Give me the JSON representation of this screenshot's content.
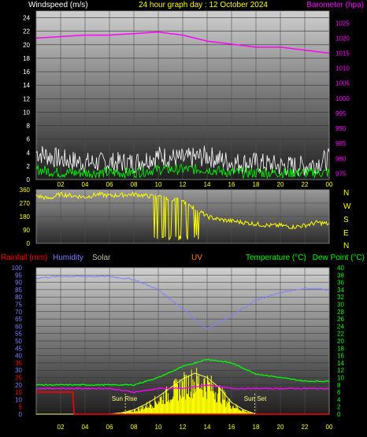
{
  "header": {
    "windspeed_label": "Windspeed (m/s)",
    "title": "24 hour graph day : 12 October 2024",
    "barometer_label": "Barometer (hpa)"
  },
  "compass": [
    "N",
    "W",
    "S",
    "E",
    "N"
  ],
  "legend": {
    "rainfall": "Rainfall (mm)",
    "humidity": "Humidity",
    "solar": "Solar",
    "uv": "UV",
    "temperature": "Temperature (°C)",
    "dewpoint": "Dew Point (°C)"
  },
  "annotations": {
    "sunrise": "Sun Rise",
    "sunset": "Sun Set"
  },
  "colors": {
    "wind_label": "#ffffff",
    "title": "#ffff00",
    "barometer": "#ff00ff",
    "rain": "#ff0000",
    "humidity": "#8080ff",
    "solar": "#c0c0a0",
    "uv": "#ff8000",
    "temperature": "#00ff00",
    "dewpoint": "#00ff00",
    "direction": "#ffff00"
  },
  "chart_data": [
    {
      "type": "line",
      "title": "24 hour graph day : 12 October 2024",
      "x_ticks": [
        "02",
        "04",
        "06",
        "08",
        "10",
        "12",
        "14",
        "16",
        "18",
        "20",
        "22",
        "00"
      ],
      "left_axis": {
        "label": "Windspeed (m/s)",
        "ylim": [
          0,
          25
        ],
        "ticks": [
          0,
          2,
          4,
          6,
          8,
          10,
          12,
          14,
          16,
          18,
          20,
          22,
          24
        ]
      },
      "right_axis": {
        "label": "Barometer (hpa)",
        "ylim": [
          973,
          1029
        ],
        "ticks": [
          975,
          980,
          985,
          990,
          995,
          1000,
          1005,
          1010,
          1015,
          1020,
          1025
        ]
      },
      "series": [
        {
          "name": "Barometer (hpa)",
          "axis": "right",
          "x": [
            0,
            2,
            4,
            6,
            8,
            10,
            12,
            14,
            16,
            18,
            20,
            22,
            24
          ],
          "values": [
            1020,
            1020.5,
            1021,
            1021,
            1021.5,
            1022,
            1021,
            1019,
            1018,
            1017,
            1017,
            1016,
            1015
          ]
        },
        {
          "name": "gust",
          "axis": "left",
          "x": [
            0,
            2,
            4,
            6,
            8,
            10,
            12,
            14,
            16,
            18,
            20,
            22,
            24
          ],
          "values": [
            4,
            3,
            2.5,
            2.5,
            2.5,
            3.5,
            3,
            3.5,
            2.5,
            2.5,
            2,
            2,
            3
          ]
        },
        {
          "name": "average",
          "axis": "left",
          "x": [
            0,
            2,
            4,
            6,
            8,
            10,
            12,
            14,
            16,
            18,
            20,
            22,
            24
          ],
          "values": [
            1.5,
            1,
            1,
            1,
            1,
            1.5,
            1.5,
            1.5,
            1,
            1,
            1,
            1,
            1
          ]
        }
      ]
    },
    {
      "type": "scatter",
      "x_ticks": [
        "02",
        "04",
        "06",
        "08",
        "10",
        "12",
        "14",
        "16",
        "18",
        "20",
        "22",
        "00"
      ],
      "ylim": [
        0,
        360
      ],
      "y_ticks": [
        0,
        90,
        180,
        270,
        360
      ],
      "series": [
        {
          "name": "direction",
          "x": [
            0,
            1,
            2,
            3,
            4,
            5,
            6,
            7,
            8,
            9,
            10,
            11,
            12,
            13,
            14,
            15,
            16,
            17,
            18,
            19,
            20,
            21,
            22,
            23,
            24
          ],
          "values": [
            320,
            300,
            330,
            320,
            310,
            330,
            320,
            325,
            330,
            320,
            310,
            300,
            280,
            240,
            180,
            160,
            150,
            140,
            130,
            120,
            120,
            110,
            120,
            140,
            130
          ]
        }
      ]
    },
    {
      "type": "line",
      "x_ticks": [
        "02",
        "04",
        "06",
        "08",
        "10",
        "12",
        "14",
        "16",
        "18",
        "20",
        "22",
        "00"
      ],
      "left_axis": {
        "label": "Rainfall (mm)",
        "ylim": [
          0,
          100
        ],
        "ticks": [
          0,
          5,
          10,
          15,
          20,
          25,
          30,
          35,
          40,
          45,
          50,
          55,
          60,
          65,
          70,
          75,
          80,
          85,
          90,
          95,
          100
        ]
      },
      "right_axis": {
        "label": "Temperature (°C)",
        "ylim": [
          0,
          40
        ],
        "ticks": [
          0,
          2,
          4,
          6,
          8,
          10,
          12,
          14,
          16,
          18,
          20,
          22,
          24,
          26,
          28,
          30,
          32,
          34,
          36,
          38,
          40
        ]
      },
      "series": [
        {
          "name": "Humidity",
          "axis": "left",
          "x": [
            0,
            2,
            4,
            6,
            8,
            10,
            12,
            14,
            16,
            18,
            20,
            22,
            24
          ],
          "values": [
            93,
            94,
            94,
            94,
            92,
            85,
            72,
            58,
            67,
            78,
            83,
            86,
            85
          ]
        },
        {
          "name": "Temperature (°C)",
          "axis": "right",
          "x": [
            0,
            2,
            4,
            6,
            8,
            10,
            12,
            14,
            16,
            18,
            20,
            22,
            24
          ],
          "values": [
            8,
            8,
            8,
            8,
            8,
            10,
            13,
            15,
            14,
            11,
            10,
            9,
            9
          ]
        },
        {
          "name": "Dew Point (°C)",
          "axis": "right",
          "x": [
            0,
            2,
            4,
            6,
            8,
            10,
            12,
            14,
            16,
            18,
            20,
            22,
            24
          ],
          "values": [
            7,
            7,
            7,
            7,
            6,
            7,
            7,
            8,
            7,
            7,
            7,
            7,
            7
          ]
        },
        {
          "name": "Rainfall (mm)",
          "axis": "left",
          "x": [
            0,
            3,
            3.1,
            24
          ],
          "values": [
            15,
            15,
            0,
            0
          ]
        },
        {
          "name": "Solar",
          "axis": "left",
          "x": [
            0,
            6,
            7,
            8,
            9,
            10,
            11,
            12,
            13,
            14,
            15,
            16,
            17,
            18,
            24
          ],
          "values": [
            0,
            0,
            1,
            3,
            7,
            12,
            18,
            24,
            28,
            25,
            18,
            8,
            3,
            0,
            0
          ]
        }
      ]
    }
  ]
}
